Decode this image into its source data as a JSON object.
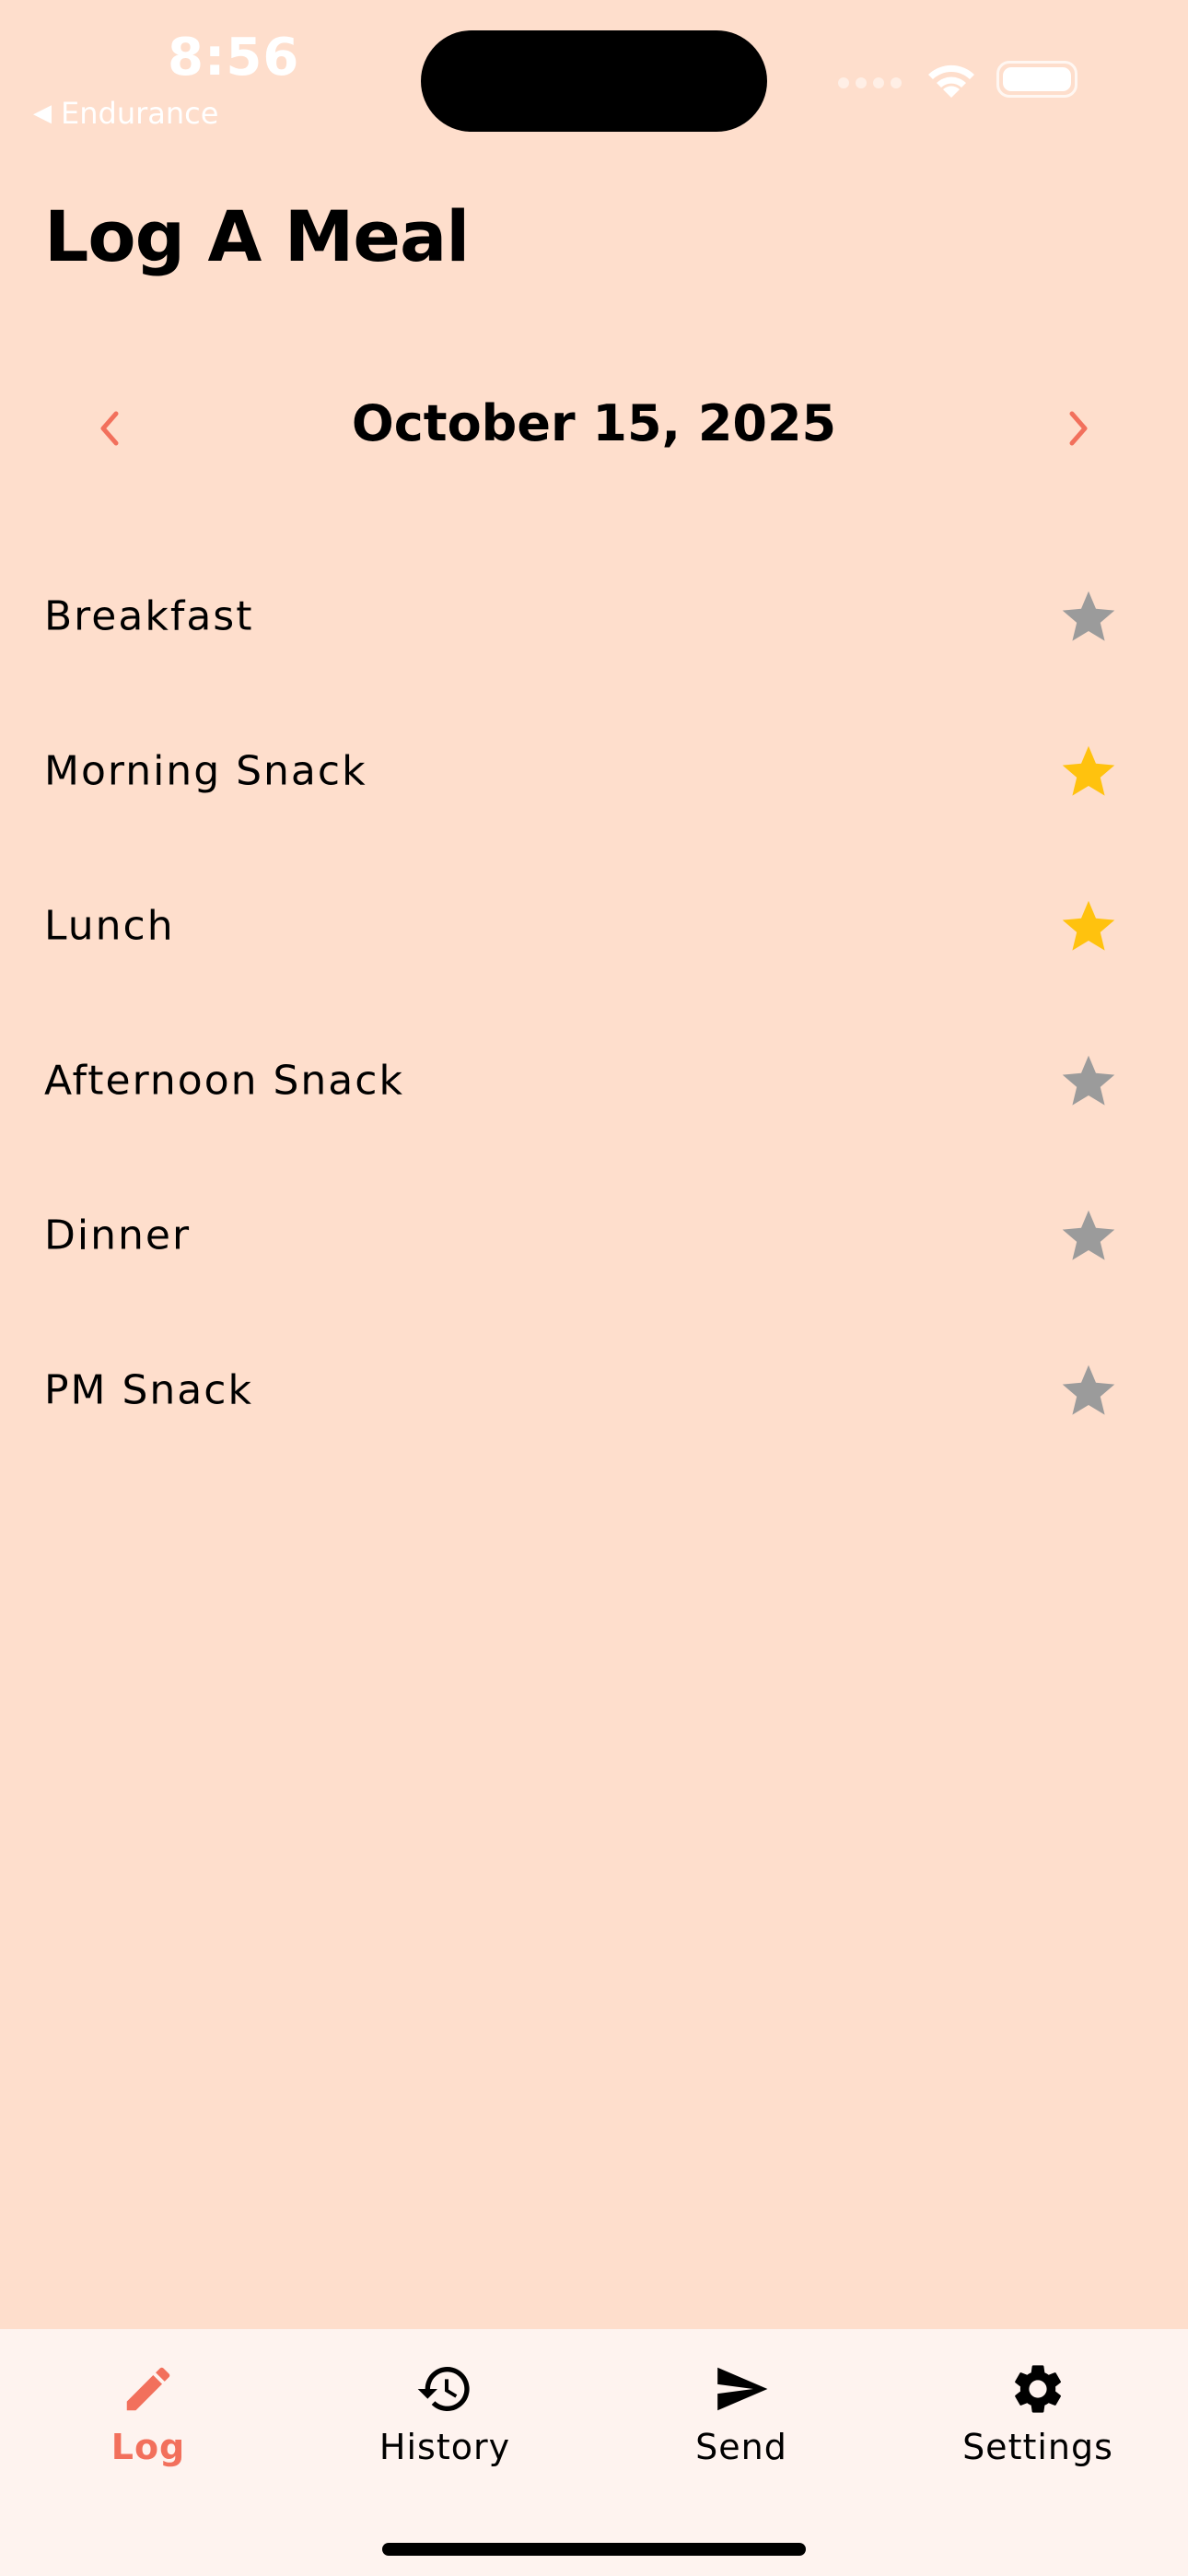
{
  "status_bar": {
    "time": "8:56",
    "back_app": "Endurance"
  },
  "header": {
    "title": "Log A Meal"
  },
  "date_nav": {
    "date": "October 15, 2025"
  },
  "meals": [
    {
      "label": "Breakfast",
      "starred": false
    },
    {
      "label": "Morning Snack",
      "starred": true
    },
    {
      "label": "Lunch",
      "starred": true
    },
    {
      "label": "Afternoon Snack",
      "starred": false
    },
    {
      "label": "Dinner",
      "starred": false
    },
    {
      "label": "PM Snack",
      "starred": false
    }
  ],
  "tabs": [
    {
      "label": "Log",
      "icon": "pencil-icon",
      "active": true
    },
    {
      "label": "History",
      "icon": "history-icon",
      "active": false
    },
    {
      "label": "Send",
      "icon": "send-icon",
      "active": false
    },
    {
      "label": "Settings",
      "icon": "gear-icon",
      "active": false
    }
  ],
  "colors": {
    "background": "#FEDECC",
    "accent": "#F2705C",
    "star_on": "#FFC20E",
    "star_off": "#9B9B9B",
    "tab_bar": "#FEF3EF"
  }
}
